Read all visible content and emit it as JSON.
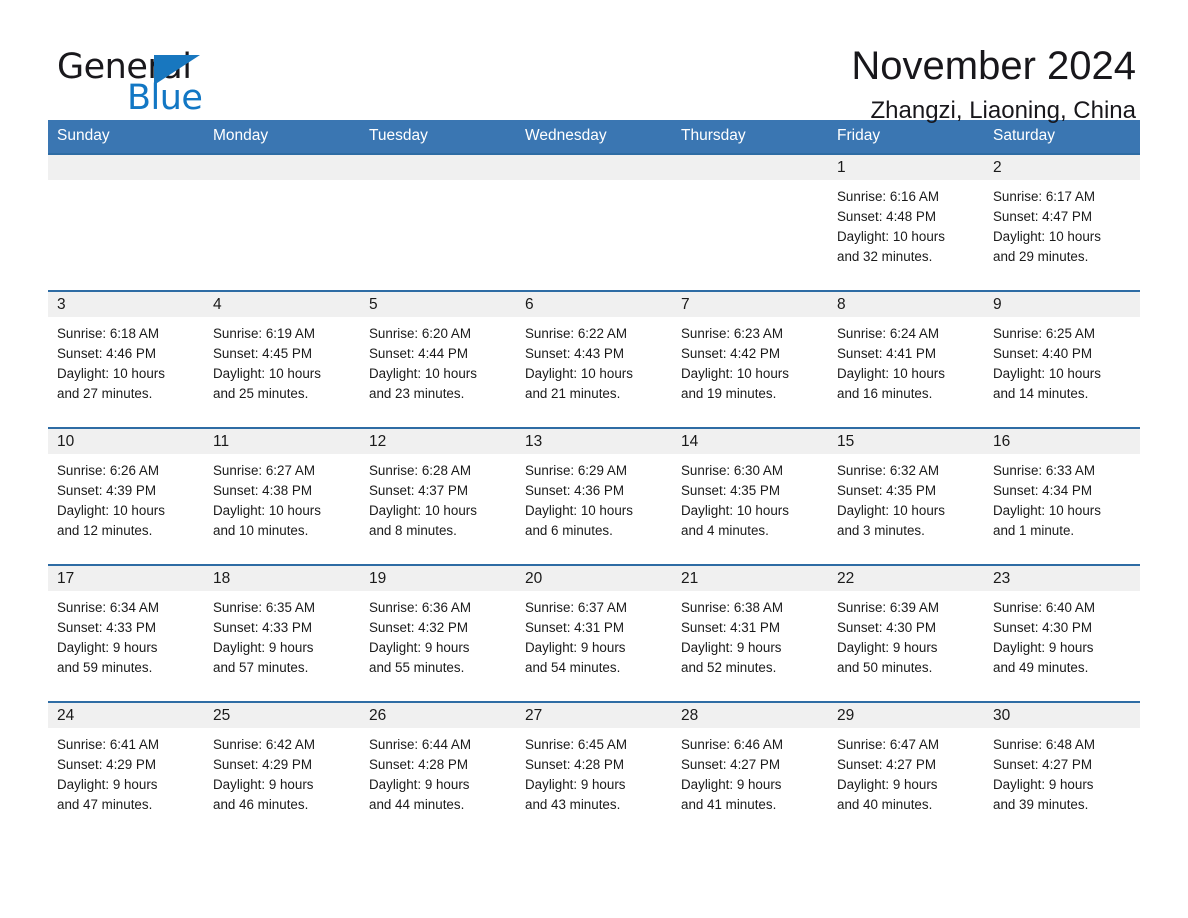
{
  "brand": {
    "name_part1": "General",
    "name_part2": "Blue",
    "triangle_icon": "triangle-icon",
    "accent_color": "#1277c4"
  },
  "header": {
    "title": "November 2024",
    "subtitle": "Zhangzi, Liaoning, China"
  },
  "theme": {
    "header_blue": "#3a76b2",
    "row_divider_blue": "#2e6ca4",
    "daynum_strip_gray": "#f0f0f0"
  },
  "weekday_headers": [
    "Sunday",
    "Monday",
    "Tuesday",
    "Wednesday",
    "Thursday",
    "Friday",
    "Saturday"
  ],
  "weeks": [
    [
      {
        "day": "",
        "sunrise": "",
        "sunset": "",
        "daylight_line1": "",
        "daylight_line2": "",
        "empty": true
      },
      {
        "day": "",
        "sunrise": "",
        "sunset": "",
        "daylight_line1": "",
        "daylight_line2": "",
        "empty": true
      },
      {
        "day": "",
        "sunrise": "",
        "sunset": "",
        "daylight_line1": "",
        "daylight_line2": "",
        "empty": true
      },
      {
        "day": "",
        "sunrise": "",
        "sunset": "",
        "daylight_line1": "",
        "daylight_line2": "",
        "empty": true
      },
      {
        "day": "",
        "sunrise": "",
        "sunset": "",
        "daylight_line1": "",
        "daylight_line2": "",
        "empty": true
      },
      {
        "day": "1",
        "sunrise": "Sunrise: 6:16 AM",
        "sunset": "Sunset: 4:48 PM",
        "daylight_line1": "Daylight: 10 hours",
        "daylight_line2": "and 32 minutes.",
        "empty": false
      },
      {
        "day": "2",
        "sunrise": "Sunrise: 6:17 AM",
        "sunset": "Sunset: 4:47 PM",
        "daylight_line1": "Daylight: 10 hours",
        "daylight_line2": "and 29 minutes.",
        "empty": false
      }
    ],
    [
      {
        "day": "3",
        "sunrise": "Sunrise: 6:18 AM",
        "sunset": "Sunset: 4:46 PM",
        "daylight_line1": "Daylight: 10 hours",
        "daylight_line2": "and 27 minutes.",
        "empty": false
      },
      {
        "day": "4",
        "sunrise": "Sunrise: 6:19 AM",
        "sunset": "Sunset: 4:45 PM",
        "daylight_line1": "Daylight: 10 hours",
        "daylight_line2": "and 25 minutes.",
        "empty": false
      },
      {
        "day": "5",
        "sunrise": "Sunrise: 6:20 AM",
        "sunset": "Sunset: 4:44 PM",
        "daylight_line1": "Daylight: 10 hours",
        "daylight_line2": "and 23 minutes.",
        "empty": false
      },
      {
        "day": "6",
        "sunrise": "Sunrise: 6:22 AM",
        "sunset": "Sunset: 4:43 PM",
        "daylight_line1": "Daylight: 10 hours",
        "daylight_line2": "and 21 minutes.",
        "empty": false
      },
      {
        "day": "7",
        "sunrise": "Sunrise: 6:23 AM",
        "sunset": "Sunset: 4:42 PM",
        "daylight_line1": "Daylight: 10 hours",
        "daylight_line2": "and 19 minutes.",
        "empty": false
      },
      {
        "day": "8",
        "sunrise": "Sunrise: 6:24 AM",
        "sunset": "Sunset: 4:41 PM",
        "daylight_line1": "Daylight: 10 hours",
        "daylight_line2": "and 16 minutes.",
        "empty": false
      },
      {
        "day": "9",
        "sunrise": "Sunrise: 6:25 AM",
        "sunset": "Sunset: 4:40 PM",
        "daylight_line1": "Daylight: 10 hours",
        "daylight_line2": "and 14 minutes.",
        "empty": false
      }
    ],
    [
      {
        "day": "10",
        "sunrise": "Sunrise: 6:26 AM",
        "sunset": "Sunset: 4:39 PM",
        "daylight_line1": "Daylight: 10 hours",
        "daylight_line2": "and 12 minutes.",
        "empty": false
      },
      {
        "day": "11",
        "sunrise": "Sunrise: 6:27 AM",
        "sunset": "Sunset: 4:38 PM",
        "daylight_line1": "Daylight: 10 hours",
        "daylight_line2": "and 10 minutes.",
        "empty": false
      },
      {
        "day": "12",
        "sunrise": "Sunrise: 6:28 AM",
        "sunset": "Sunset: 4:37 PM",
        "daylight_line1": "Daylight: 10 hours",
        "daylight_line2": "and 8 minutes.",
        "empty": false
      },
      {
        "day": "13",
        "sunrise": "Sunrise: 6:29 AM",
        "sunset": "Sunset: 4:36 PM",
        "daylight_line1": "Daylight: 10 hours",
        "daylight_line2": "and 6 minutes.",
        "empty": false
      },
      {
        "day": "14",
        "sunrise": "Sunrise: 6:30 AM",
        "sunset": "Sunset: 4:35 PM",
        "daylight_line1": "Daylight: 10 hours",
        "daylight_line2": "and 4 minutes.",
        "empty": false
      },
      {
        "day": "15",
        "sunrise": "Sunrise: 6:32 AM",
        "sunset": "Sunset: 4:35 PM",
        "daylight_line1": "Daylight: 10 hours",
        "daylight_line2": "and 3 minutes.",
        "empty": false
      },
      {
        "day": "16",
        "sunrise": "Sunrise: 6:33 AM",
        "sunset": "Sunset: 4:34 PM",
        "daylight_line1": "Daylight: 10 hours",
        "daylight_line2": "and 1 minute.",
        "empty": false
      }
    ],
    [
      {
        "day": "17",
        "sunrise": "Sunrise: 6:34 AM",
        "sunset": "Sunset: 4:33 PM",
        "daylight_line1": "Daylight: 9 hours",
        "daylight_line2": "and 59 minutes.",
        "empty": false
      },
      {
        "day": "18",
        "sunrise": "Sunrise: 6:35 AM",
        "sunset": "Sunset: 4:33 PM",
        "daylight_line1": "Daylight: 9 hours",
        "daylight_line2": "and 57 minutes.",
        "empty": false
      },
      {
        "day": "19",
        "sunrise": "Sunrise: 6:36 AM",
        "sunset": "Sunset: 4:32 PM",
        "daylight_line1": "Daylight: 9 hours",
        "daylight_line2": "and 55 minutes.",
        "empty": false
      },
      {
        "day": "20",
        "sunrise": "Sunrise: 6:37 AM",
        "sunset": "Sunset: 4:31 PM",
        "daylight_line1": "Daylight: 9 hours",
        "daylight_line2": "and 54 minutes.",
        "empty": false
      },
      {
        "day": "21",
        "sunrise": "Sunrise: 6:38 AM",
        "sunset": "Sunset: 4:31 PM",
        "daylight_line1": "Daylight: 9 hours",
        "daylight_line2": "and 52 minutes.",
        "empty": false
      },
      {
        "day": "22",
        "sunrise": "Sunrise: 6:39 AM",
        "sunset": "Sunset: 4:30 PM",
        "daylight_line1": "Daylight: 9 hours",
        "daylight_line2": "and 50 minutes.",
        "empty": false
      },
      {
        "day": "23",
        "sunrise": "Sunrise: 6:40 AM",
        "sunset": "Sunset: 4:30 PM",
        "daylight_line1": "Daylight: 9 hours",
        "daylight_line2": "and 49 minutes.",
        "empty": false
      }
    ],
    [
      {
        "day": "24",
        "sunrise": "Sunrise: 6:41 AM",
        "sunset": "Sunset: 4:29 PM",
        "daylight_line1": "Daylight: 9 hours",
        "daylight_line2": "and 47 minutes.",
        "empty": false
      },
      {
        "day": "25",
        "sunrise": "Sunrise: 6:42 AM",
        "sunset": "Sunset: 4:29 PM",
        "daylight_line1": "Daylight: 9 hours",
        "daylight_line2": "and 46 minutes.",
        "empty": false
      },
      {
        "day": "26",
        "sunrise": "Sunrise: 6:44 AM",
        "sunset": "Sunset: 4:28 PM",
        "daylight_line1": "Daylight: 9 hours",
        "daylight_line2": "and 44 minutes.",
        "empty": false
      },
      {
        "day": "27",
        "sunrise": "Sunrise: 6:45 AM",
        "sunset": "Sunset: 4:28 PM",
        "daylight_line1": "Daylight: 9 hours",
        "daylight_line2": "and 43 minutes.",
        "empty": false
      },
      {
        "day": "28",
        "sunrise": "Sunrise: 6:46 AM",
        "sunset": "Sunset: 4:27 PM",
        "daylight_line1": "Daylight: 9 hours",
        "daylight_line2": "and 41 minutes.",
        "empty": false
      },
      {
        "day": "29",
        "sunrise": "Sunrise: 6:47 AM",
        "sunset": "Sunset: 4:27 PM",
        "daylight_line1": "Daylight: 9 hours",
        "daylight_line2": "and 40 minutes.",
        "empty": false
      },
      {
        "day": "30",
        "sunrise": "Sunrise: 6:48 AM",
        "sunset": "Sunset: 4:27 PM",
        "daylight_line1": "Daylight: 9 hours",
        "daylight_line2": "and 39 minutes.",
        "empty": false
      }
    ]
  ]
}
